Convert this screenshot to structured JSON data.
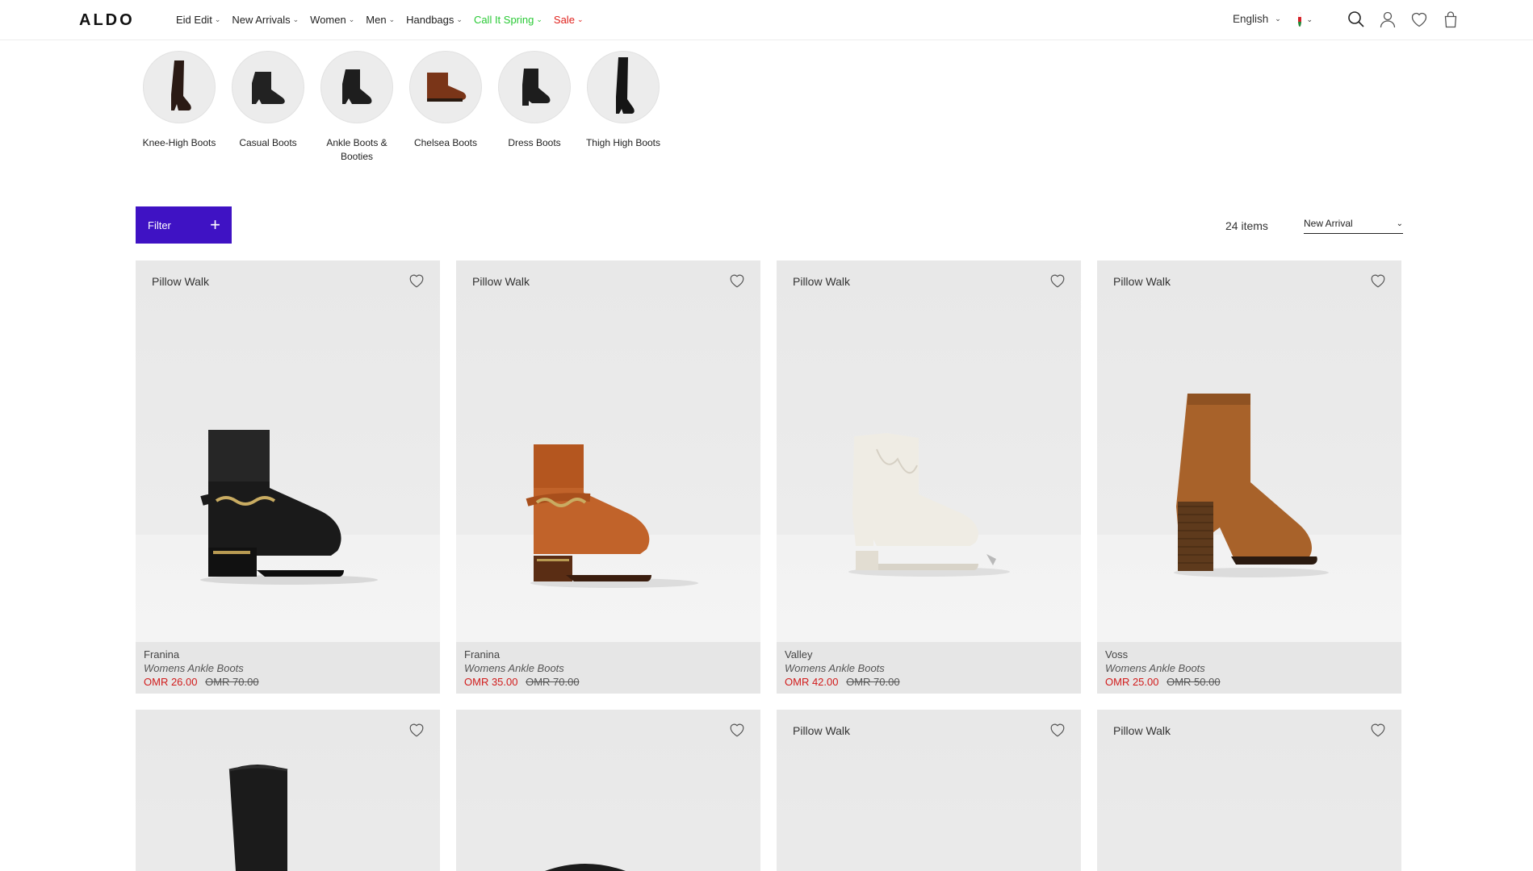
{
  "header": {
    "logo": "ALDO",
    "nav": [
      {
        "label": "Eid Edit"
      },
      {
        "label": "New Arrivals"
      },
      {
        "label": "Women"
      },
      {
        "label": "Men"
      },
      {
        "label": "Handbags"
      },
      {
        "label": "Call It Spring",
        "color": "#28c934"
      },
      {
        "label": "Sale",
        "color": "#e0201b"
      }
    ],
    "language": "English",
    "icons": [
      "flag-icon",
      "search-icon",
      "account-icon",
      "wishlist-icon",
      "bag-icon"
    ]
  },
  "categories": [
    {
      "label": "Knee-High Boots"
    },
    {
      "label": "Casual Boots"
    },
    {
      "label": "Ankle Boots & Booties"
    },
    {
      "label": "Chelsea Boots"
    },
    {
      "label": "Dress Boots"
    },
    {
      "label": "Thigh High Boots"
    }
  ],
  "toolbar": {
    "filter_label": "Filter",
    "items_count": "24 items",
    "sort_value": "New Arrival",
    "filter_color": "#3f12c4"
  },
  "products": [
    {
      "badge": "Pillow Walk",
      "name": "Franina",
      "category": "Womens Ankle Boots",
      "price": "OMR 26.00",
      "old_price": "OMR 70.00",
      "color": "black"
    },
    {
      "badge": "Pillow Walk",
      "name": "Franina",
      "category": "Womens Ankle Boots",
      "price": "OMR 35.00",
      "old_price": "OMR 70.00",
      "color": "cognac"
    },
    {
      "badge": "Pillow Walk",
      "name": "Valley",
      "category": "Womens Ankle Boots",
      "price": "OMR 42.00",
      "old_price": "OMR 70.00",
      "color": "white"
    },
    {
      "badge": "Pillow Walk",
      "name": "Voss",
      "category": "Womens Ankle Boots",
      "price": "OMR 25.00",
      "old_price": "OMR 50.00",
      "color": "brown"
    },
    {
      "badge": ""
    },
    {
      "badge": ""
    },
    {
      "badge": "Pillow Walk"
    },
    {
      "badge": "Pillow Walk"
    }
  ]
}
